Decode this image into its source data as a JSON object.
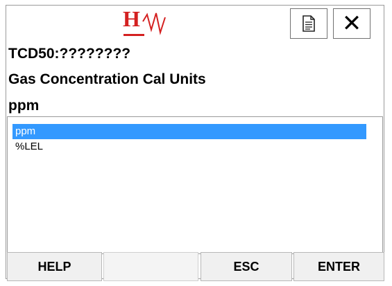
{
  "header": {
    "logo_letter": "H",
    "icons": {
      "document": "document-icon",
      "close": "close-icon"
    },
    "close_glyph": "✕"
  },
  "device_id": "TCD50:????????",
  "parameter_title": "Gas Concentration Cal Units",
  "current_value": "ppm",
  "options": [
    {
      "label": "ppm",
      "selected": true
    },
    {
      "label": "%LEL",
      "selected": false
    }
  ],
  "softkeys": {
    "help": "HELP",
    "blank": "",
    "esc": "ESC",
    "enter": "ENTER"
  },
  "colors": {
    "logo": "#d42020",
    "selection": "#3399ff"
  }
}
